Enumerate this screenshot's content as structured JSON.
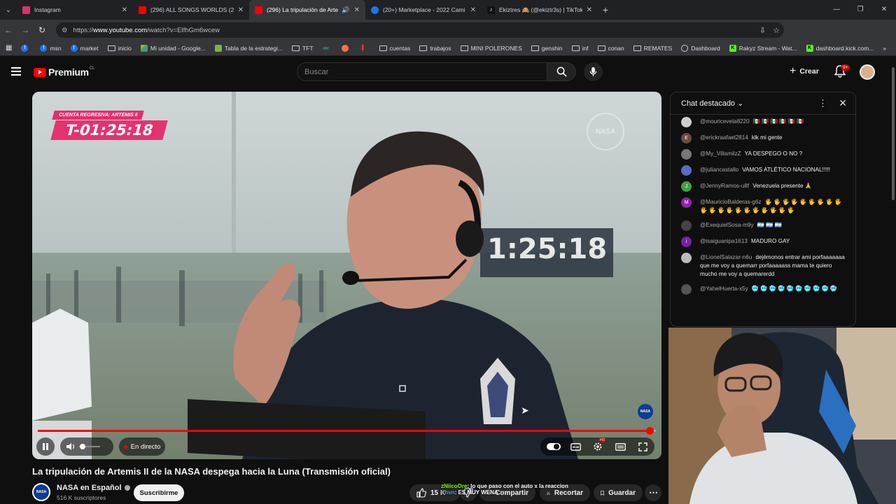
{
  "browser": {
    "tabs": [
      {
        "title": "Instagram",
        "color": "#e1306c",
        "active": false
      },
      {
        "title": "(296) ALL SONGS WORLDS (20",
        "color": "#ff0000",
        "active": false
      },
      {
        "title": "(296) La tripulación de Arte",
        "color": "#ff0000",
        "active": true
      },
      {
        "title": "(20+) Marketplace - 2022 Cami",
        "color": "#1877f2",
        "active": false
      },
      {
        "title": "Ekiztres 🙈 (@ekiztr3s) | TikTok",
        "color": "#111111",
        "active": false
      }
    ],
    "url_prefix": "https://",
    "url_host": "www.youtube.com",
    "url_path": "/watch?v=ElfhGm6wcew",
    "bookmarks": [
      "msn",
      "market",
      "inicio",
      "Mi unidad - Google...",
      "Tabla de la estrategi...",
      "TFT",
      "cuentas",
      "trabajos",
      "MINI POLERONES",
      "genshin",
      "inf",
      "conan",
      "REMATES",
      "Dashboard",
      "Rakyz Stream - Wat...",
      "dashboard.kick.com..."
    ]
  },
  "youtube": {
    "logo_text": "Premium",
    "logo_country": "CL",
    "search_placeholder": "Buscar",
    "create_label": "Crear",
    "notif_badge": "9+"
  },
  "player": {
    "countdown_label": "CUENTA REGRESIVA: ARTEMIS II",
    "countdown_value": "T-01:25:18",
    "background_clock": "1:25:18",
    "watermark": "NASA",
    "live_label": "En directo",
    "progress": 0.99,
    "volume": 0.1
  },
  "video": {
    "title": "La tripulación de Artemis II de la NASA despega hacia la Luna (Transmisión oficial)",
    "channel": "NASA en Español",
    "subscribers": "516 K suscriptores",
    "subscribe_label": "Suscribirme",
    "likes": "15 K",
    "share_label": "Compartir",
    "clip_label": "Recortar",
    "save_label": "Guardar"
  },
  "stream_overlay": {
    "line1_user": "zNiicoOre",
    "line1_text": ": lo que paso con el auto x la reaccion",
    "line2_user": "tthvn",
    "line2_text": ": ES MUY WENA"
  },
  "chat": {
    "header": "Chat destacado",
    "messages": [
      {
        "user": "@mouricevela8220",
        "text": "🇲🇽 🇲🇽 🇲🇽 🇲🇽 🇲🇽 🇲🇽",
        "av": "#ccc",
        "initial": ""
      },
      {
        "user": "@erickraafael2814",
        "text": "klk mi gente",
        "av": "#6d4c41",
        "initial": "E"
      },
      {
        "user": "@My_VillamilzZ",
        "text": "YA DESPEGO O NO ?",
        "av": "#777",
        "initial": ""
      },
      {
        "user": "@juliancastallo",
        "text": "VAMOS ATLÉTICO NACIONAL!!!!!",
        "av": "#5c6bc0",
        "initial": ""
      },
      {
        "user": "@JennyRamos-u8f",
        "text": "Venezuela presente 🙏",
        "av": "#43a047",
        "initial": "J"
      },
      {
        "user": "@MauricioBalderas-g6z",
        "text": "🖐 🖐 🖐 🖐 🖐 🖐 🖐 🖐 🖐 🖐 🖐 🖐 🖐 🖐 🖐 🖐 🖐 🖐 🖐 🖐",
        "av": "#8e24aa",
        "initial": "M"
      },
      {
        "user": "@ExequielSosa-m9y",
        "text": "🇦🇷 🇦🇷 🇦🇷",
        "av": "#444",
        "initial": ""
      },
      {
        "user": "@isaiguanipa1613",
        "text": "MADURO GAY",
        "av": "#7b1fa2",
        "initial": "i"
      },
      {
        "user": "@LionelSalazar-n6u",
        "text": "dejémonos entrar ami porfaaaaaaa que me voy a quemarr porfaaaaass mama te quiero mucho me voy a quemarerdd",
        "av": "#bbb",
        "initial": ""
      },
      {
        "user": "@YahelHuerta-x5y",
        "text": "🥶 🥶 🥶 🥶 🥶 🥶 🥶 🥶 🥶 🥶",
        "av": "#555",
        "initial": ""
      }
    ]
  }
}
